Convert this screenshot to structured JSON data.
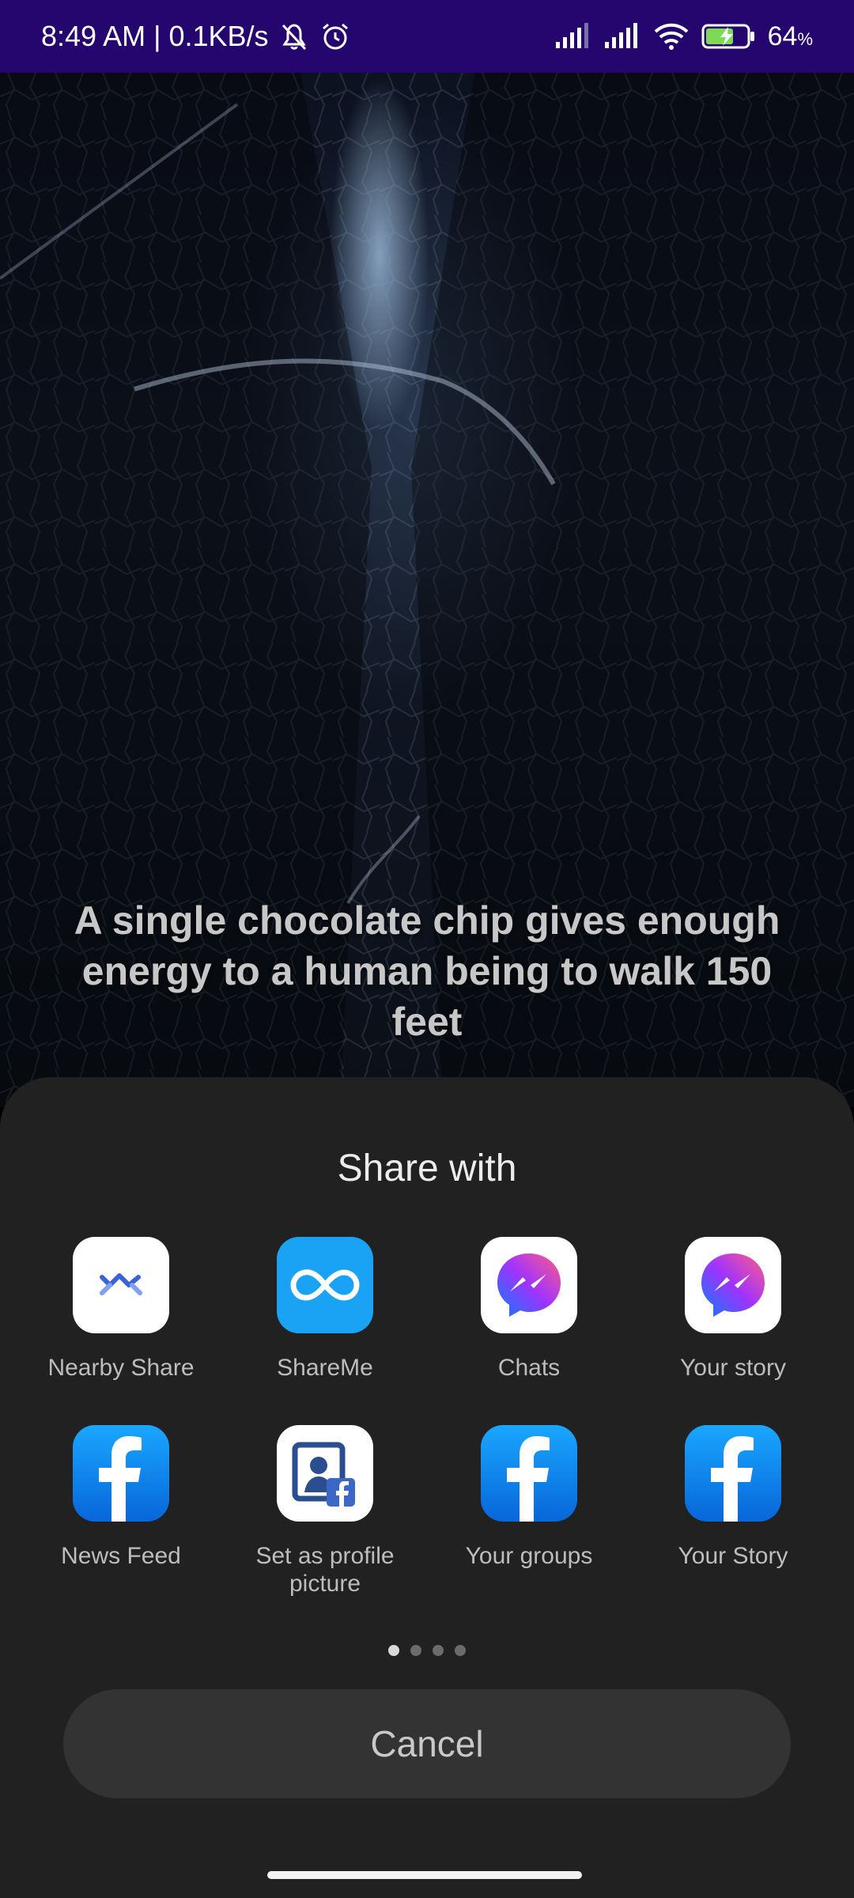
{
  "status_bar": {
    "time_speed": "8:49 AM | 0.1KB/s",
    "battery_percent": "64",
    "battery_unit": "%",
    "background_color": "#25066f",
    "icons": [
      "mute-bell-icon",
      "alarm-icon",
      "signal-icon",
      "signal-icon",
      "wifi-icon",
      "battery-charging-icon"
    ]
  },
  "wallpaper": {
    "quote": "A single chocolate chip gives enough energy to a human being to walk 150 feet"
  },
  "share_sheet": {
    "title": "Share with",
    "apps": [
      {
        "label": "Nearby Share",
        "icon": "nearby-share-icon"
      },
      {
        "label": "ShareMe",
        "icon": "shareme-icon"
      },
      {
        "label": "Chats",
        "icon": "messenger-icon"
      },
      {
        "label": "Your story",
        "icon": "messenger-icon"
      },
      {
        "label": "News Feed",
        "icon": "facebook-icon"
      },
      {
        "label": "Set as profile picture",
        "icon": "facebook-profile-picture-icon"
      },
      {
        "label": "Your groups",
        "icon": "facebook-icon"
      },
      {
        "label": "Your Story",
        "icon": "facebook-icon"
      }
    ],
    "page_count": 4,
    "current_page": 1,
    "cancel_label": "Cancel"
  }
}
